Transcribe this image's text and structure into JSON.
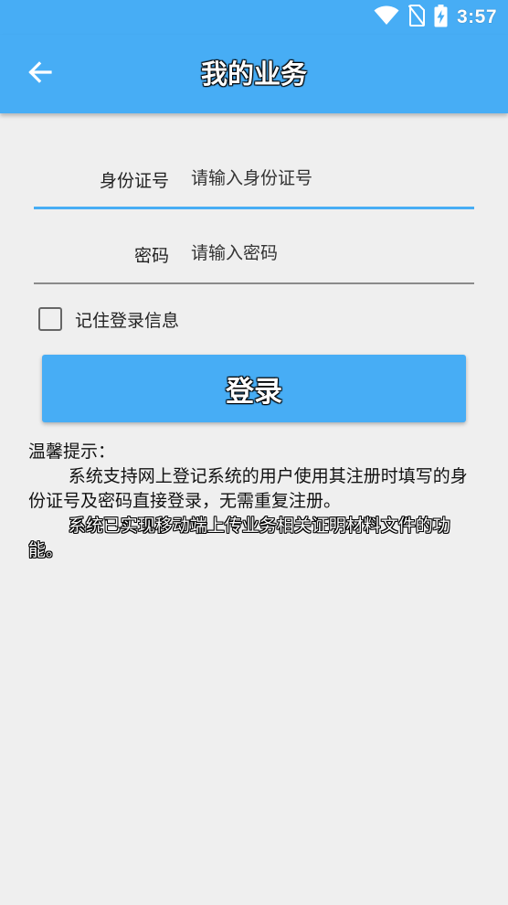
{
  "status_bar": {
    "time": "3:57",
    "icons": [
      "wifi-icon",
      "no-sim-icon",
      "battery-charging-icon"
    ]
  },
  "app_bar": {
    "title": "我的业务",
    "back_icon": "arrow-left-icon"
  },
  "form": {
    "id_label": "身份证号",
    "id_placeholder": "请输入身份证号",
    "password_label": "密码",
    "password_placeholder": "请输入密码",
    "remember_label": "记住登录信息",
    "remember_checked": false,
    "login_label": "登录"
  },
  "tips": {
    "title": "温馨提示：",
    "paragraph1": "系统支持网上登记系统的用户使用其注册时填写的身份证号及密码直接登录，无需重复注册。",
    "paragraph2": "系统已实现移动端上传业务相关证明材料文件的功能。"
  },
  "colors": {
    "primary": "#47adf5",
    "background": "#efefef",
    "text": "#222222"
  }
}
